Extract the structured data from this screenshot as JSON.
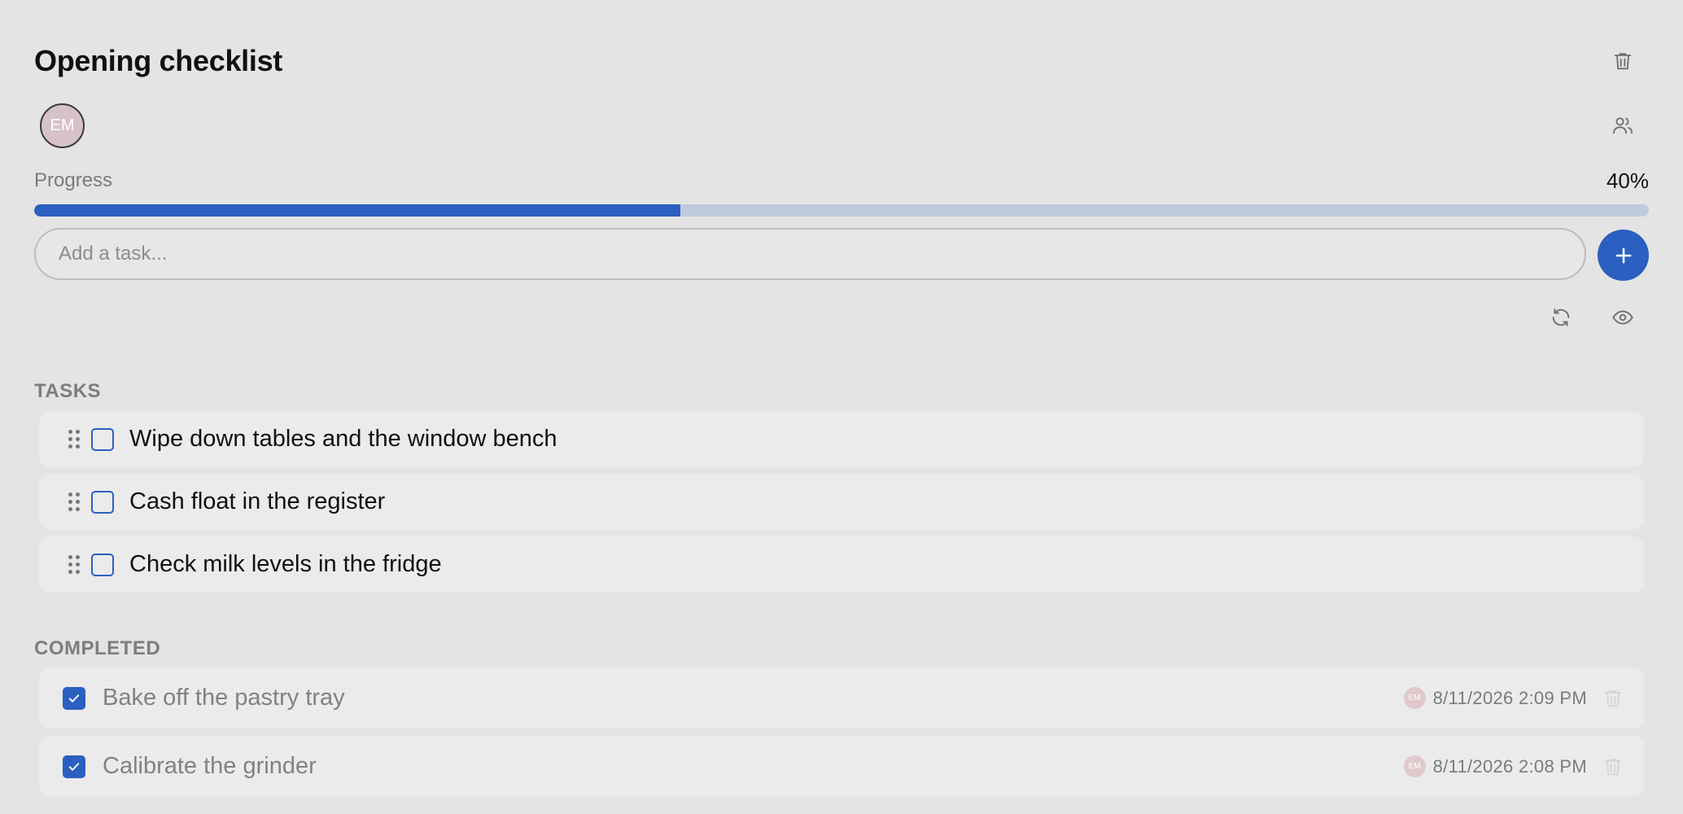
{
  "header": {
    "title": "Opening checklist",
    "delete_icon": "trash-icon"
  },
  "members": {
    "avatar_initials": "EM",
    "members_icon": "users-icon"
  },
  "progress": {
    "label": "Progress",
    "value_text": "40%",
    "value": 0.4,
    "fill_color": "#2b5fc0"
  },
  "add_task": {
    "placeholder": "Add a task...",
    "button_icon": "plus-icon"
  },
  "tools": {
    "refresh_icon": "refresh-icon",
    "visibility_icon": "eye-icon"
  },
  "tasks": {
    "label": "TASKS",
    "items": [
      {
        "text": "Wipe down tables and the window bench"
      },
      {
        "text": "Cash float in the register"
      },
      {
        "text": "Check milk levels in the fridge"
      }
    ]
  },
  "completed": {
    "label": "COMPLETED",
    "items": [
      {
        "text": "Bake off the pastry tray",
        "avatar": "EM",
        "timestamp": "8/11/2026 2:09 PM"
      },
      {
        "text": "Calibrate the grinder",
        "avatar": "EM",
        "timestamp": "8/11/2026 2:08 PM"
      }
    ]
  },
  "colors": {
    "accent": "#2b5fc0",
    "background": "#e4e4e4",
    "track": "#bfcadb"
  }
}
